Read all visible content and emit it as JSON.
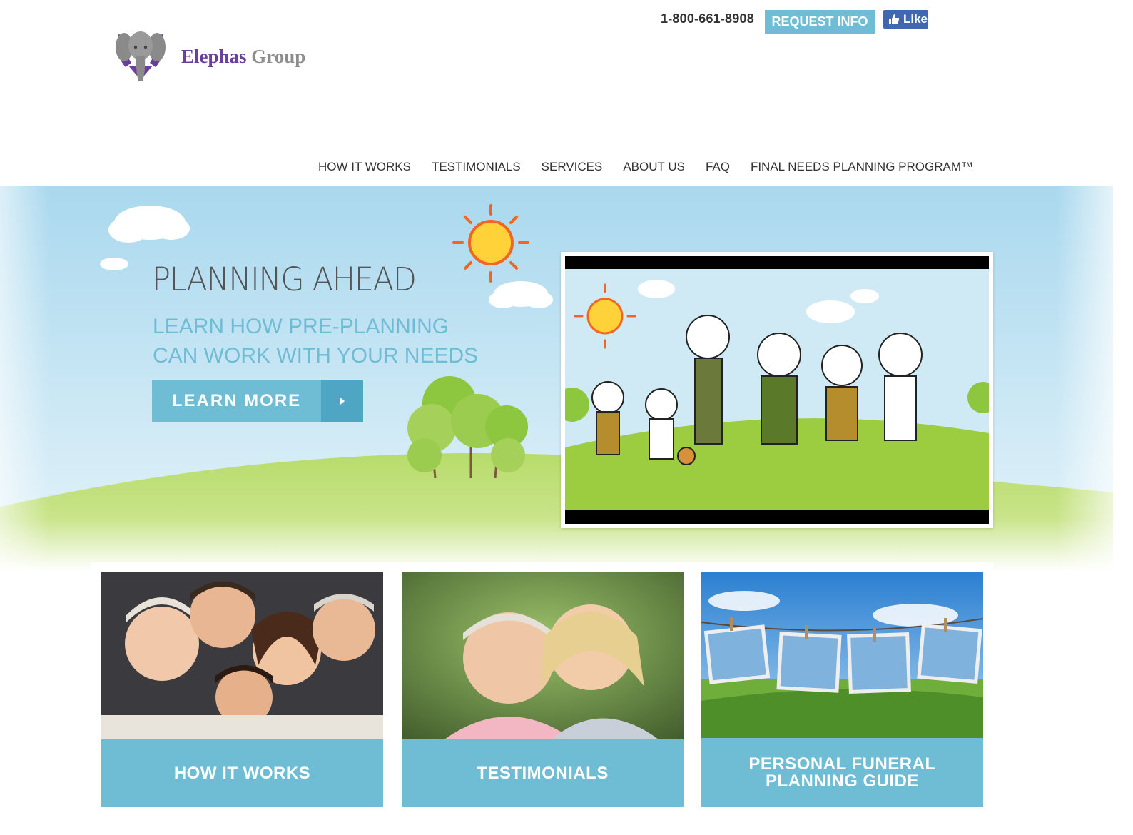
{
  "header": {
    "brand_name_1": "Elephas",
    "brand_name_2": "Group",
    "phone": "1-800-661-8908",
    "request_info_label": "REQUEST INFO",
    "like_label": "Like"
  },
  "nav": {
    "items": [
      {
        "label": "HOW IT WORKS"
      },
      {
        "label": "TESTIMONIALS"
      },
      {
        "label": "SERVICES"
      },
      {
        "label": "ABOUT US"
      },
      {
        "label": "FAQ"
      },
      {
        "label": "FINAL NEEDS PLANNING PROGRAM™"
      }
    ]
  },
  "hero": {
    "title": "PLANNING AHEAD",
    "subtitle_line1": "LEARN HOW PRE-PLANNING",
    "subtitle_line2": "CAN WORK WITH YOUR NEEDS",
    "cta_label": "LEARN MORE"
  },
  "cards": [
    {
      "label": "HOW IT WORKS",
      "icon": "family-photo"
    },
    {
      "label": "TESTIMONIALS",
      "icon": "couple-photo"
    },
    {
      "label_line1": "PERSONAL FUNERAL",
      "label_line2": "PLANNING GUIDE",
      "icon": "clothesline-photos"
    }
  ],
  "colors": {
    "accent": "#6fbcd5",
    "accent_dark": "#4ea6c4",
    "brand_purple": "#6b3fa0",
    "facebook": "#4267b2"
  }
}
